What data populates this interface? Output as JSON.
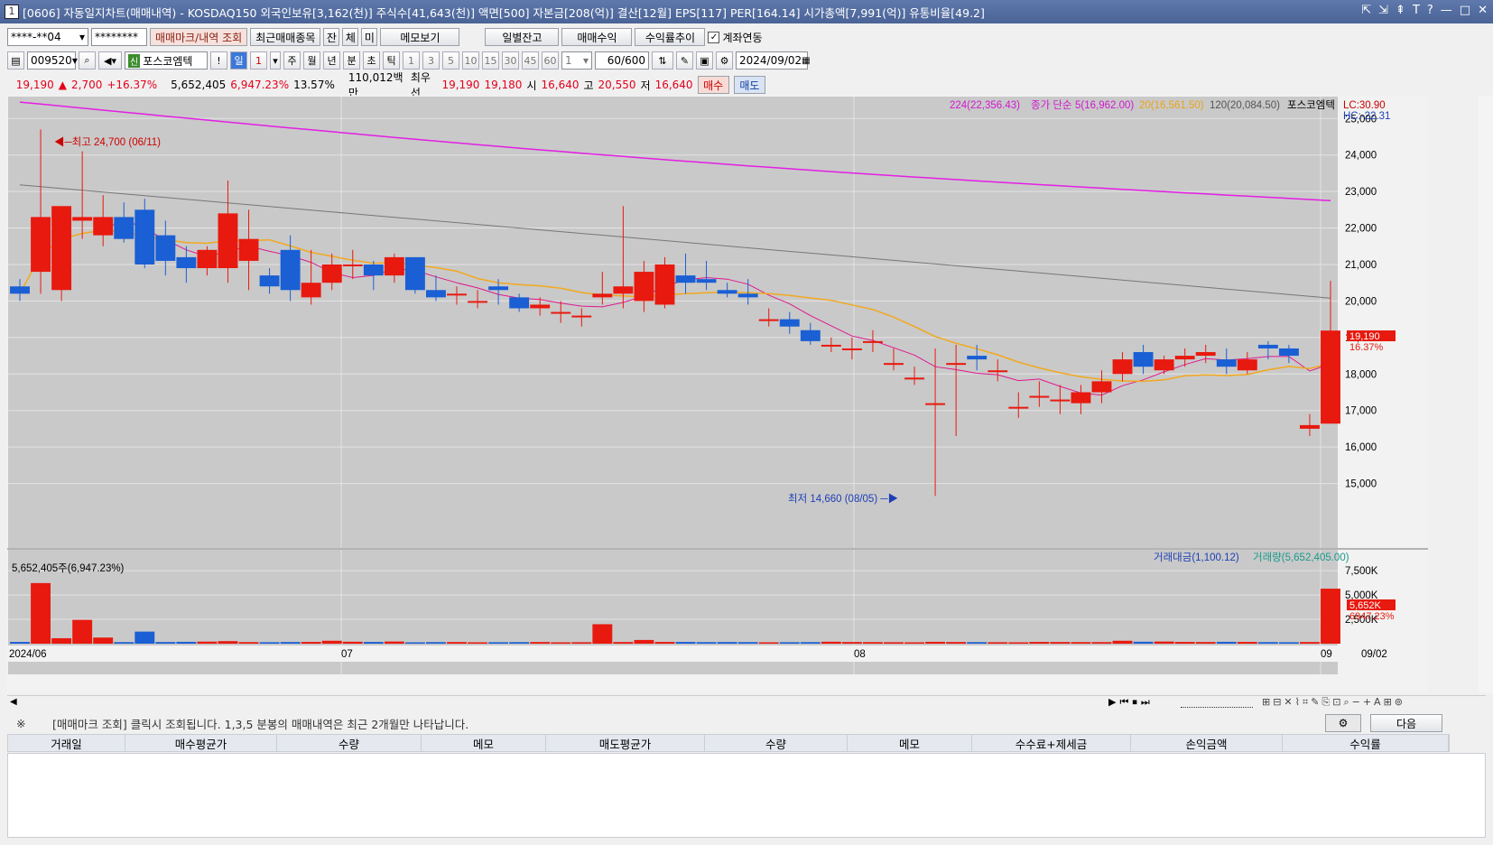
{
  "window": {
    "title": "[0606] 자동일지차트(매매내역) - KOSDAQ150 외국인보유[3,162(천)] 주식수[41,643(천)] 액면[500] 자본금[208(억)] 결산[12월] EPS[117] PER[164.14] 시가총액[7,991(억)] 유통비율[49.2]",
    "icon": "1",
    "controls": [
      "⇱",
      "⇲",
      "⇞",
      "T",
      "?",
      "—",
      "□",
      "✕"
    ]
  },
  "toolbar1": {
    "account": "****-**04",
    "password": "********",
    "trade_mark": "매매마크/내역 조회",
    "recent": "최근매매종목",
    "jan": "잔",
    "che": "체",
    "mi": "미",
    "memo": "메모보기",
    "daily": "일별잔고",
    "profit": "매매수익",
    "rate": "수익률추이",
    "link_checked": true,
    "link": "계좌연동"
  },
  "toolbar2": {
    "code": "009520",
    "stock_tag": "신",
    "stock_name": "포스코엠텍",
    "excl": "!",
    "period_labels": [
      "일",
      "1",
      "주",
      "월",
      "년",
      "분",
      "초",
      "틱"
    ],
    "minute_labels": [
      "1",
      "3",
      "5",
      "10",
      "15",
      "30",
      "45",
      "60"
    ],
    "nval": "1",
    "count": "60",
    "total": "/600",
    "date": "2024/09/02"
  },
  "pricebar": {
    "price": "19,190",
    "arrow": "▲",
    "change": "2,700",
    "pct": "+16.37%",
    "volume": "5,652,405",
    "vol_pct": "6,947.23%",
    "turnover": "13.57%",
    "amount": "110,012백만",
    "quote_label": "최우선",
    "ask": "19,190",
    "bid": "19,180",
    "open_label": "시",
    "open": "16,640",
    "high_label": "고",
    "high": "20,550",
    "low_label": "저",
    "low": "16,640",
    "buy": "매수",
    "sell": "매도"
  },
  "chart": {
    "legend": {
      "ma224": "224(22,356.43)",
      "ma_type": "종가 단순",
      "ma5": "5(16,962.00)",
      "ma20": "20(16,561.50)",
      "ma120": "120(20,084.50)",
      "stock": "포스코엠텍",
      "lc": "LC:30.90",
      "hc": "HC:-22.31"
    },
    "high_note": "최고 24,700 (06/11)",
    "low_note": "최저 14,660 (08/05)",
    "last_price": "19,190",
    "last_pct": "16.37%",
    "price_ticks": [
      "25,000",
      "24,000",
      "23,000",
      "22,000",
      "21,000",
      "20,000",
      "19,000",
      "18,000",
      "17,000",
      "16,000",
      "15,000"
    ],
    "vol_legend": {
      "amount": "거래대금(1,100.12)",
      "volume": "거래량(5,652,405.00)"
    },
    "vol_note": "5,652,405주(6,947.23%)",
    "vol_last": "5,652K",
    "vol_last_pct": "6947.23%",
    "vol_ticks": [
      "7,500K",
      "5,000K",
      "2,500K"
    ],
    "x_labels": [
      "2024/06",
      "07",
      "08",
      "09",
      "09/02"
    ],
    "colors": {
      "up": "#e8190e",
      "down": "#1a5fd4",
      "ma5": "#e0188e",
      "ma20": "#f2a81d",
      "ma120": "#777777",
      "ma224": "#e41ee4",
      "bg": "#c9c9c9"
    }
  },
  "chart_data": {
    "type": "candlestick",
    "x": [
      "06/03",
      "06/04",
      "06/05",
      "06/07",
      "06/10",
      "06/11",
      "06/12",
      "06/13",
      "06/14",
      "06/17",
      "06/18",
      "06/19",
      "06/20",
      "06/21",
      "06/24",
      "06/25",
      "06/26",
      "06/27",
      "06/28",
      "07/01",
      "07/02",
      "07/03",
      "07/04",
      "07/05",
      "07/08",
      "07/09",
      "07/10",
      "07/11",
      "07/12",
      "07/15",
      "07/16",
      "07/17",
      "07/18",
      "07/19",
      "07/22",
      "07/23",
      "07/24",
      "07/25",
      "07/26",
      "07/29",
      "07/30",
      "07/31",
      "08/01",
      "08/02",
      "08/05",
      "08/06",
      "08/07",
      "08/08",
      "08/09",
      "08/12",
      "08/13",
      "08/14",
      "08/16",
      "08/19",
      "08/20",
      "08/21",
      "08/22",
      "08/23",
      "08/26",
      "08/27",
      "08/28",
      "08/29",
      "08/30",
      "09/02"
    ],
    "open": [
      20400,
      20800,
      20300,
      22200,
      21800,
      22300,
      22500,
      21800,
      21200,
      20900,
      20900,
      21100,
      20700,
      21400,
      20100,
      20500,
      21000,
      21000,
      20700,
      21200,
      20300,
      20200,
      20000,
      20400,
      20100,
      19800,
      19700,
      19600,
      20100,
      20200,
      20000,
      19900,
      20700,
      20600,
      20300,
      20200,
      19500,
      19500,
      19200,
      18800,
      18700,
      18900,
      18300,
      17900,
      17200,
      18300,
      18500,
      18100,
      17100,
      17400,
      17300,
      17200,
      17500,
      18000,
      18600,
      18100,
      18400,
      18500,
      18400,
      18100,
      18800,
      18700,
      16500,
      16640
    ],
    "close": [
      20200,
      22300,
      22600,
      22300,
      22300,
      21700,
      21000,
      21100,
      20900,
      21400,
      22400,
      21700,
      20400,
      20300,
      20500,
      21000,
      21000,
      20700,
      21200,
      20300,
      20100,
      20200,
      20000,
      20300,
      19800,
      19900,
      19700,
      19600,
      20200,
      20400,
      20800,
      21000,
      20500,
      20500,
      20200,
      20100,
      19500,
      19300,
      18900,
      18800,
      18700,
      18900,
      18300,
      17900,
      17200,
      18300,
      18400,
      18100,
      17100,
      17400,
      17300,
      17500,
      17800,
      18400,
      18200,
      18400,
      18500,
      18600,
      18200,
      18400,
      18700,
      18500,
      16600,
      19190
    ],
    "high": [
      20600,
      24700,
      22500,
      24100,
      22900,
      22700,
      22800,
      22200,
      21500,
      21500,
      23300,
      22500,
      20900,
      21800,
      21400,
      21300,
      21400,
      21100,
      21300,
      21200,
      20700,
      20400,
      20300,
      20600,
      20200,
      20100,
      20000,
      19800,
      20800,
      22600,
      21100,
      21200,
      21300,
      21100,
      20500,
      20600,
      19800,
      19700,
      19400,
      19000,
      19000,
      19200,
      18700,
      18200,
      18700,
      18800,
      18800,
      18400,
      17500,
      17800,
      17700,
      17700,
      18100,
      18600,
      18800,
      18500,
      18700,
      18800,
      18700,
      18600,
      18900,
      18800,
      16900,
      20550
    ],
    "low": [
      20000,
      20200,
      20000,
      21700,
      21500,
      21600,
      20900,
      20700,
      20500,
      20700,
      20500,
      20300,
      20200,
      20000,
      19900,
      20300,
      20600,
      20300,
      20500,
      20200,
      20000,
      19900,
      19800,
      19900,
      19700,
      19600,
      19400,
      19300,
      19900,
      19800,
      19700,
      19800,
      20200,
      20300,
      20100,
      19900,
      19300,
      19100,
      18800,
      18600,
      18400,
      18600,
      18100,
      17700,
      14660,
      16300,
      18100,
      17800,
      16800,
      17100,
      16900,
      16900,
      17200,
      17800,
      18000,
      18000,
      18200,
      18300,
      18000,
      18000,
      18400,
      18300,
      16300,
      16640
    ],
    "volume": [
      180,
      6230,
      560,
      2450,
      630,
      160,
      1240,
      170,
      190,
      210,
      260,
      160,
      150,
      170,
      180,
      300,
      200,
      180,
      220,
      140,
      160,
      170,
      140,
      150,
      160,
      170,
      140,
      150,
      2000,
      170,
      380,
      180,
      180,
      160,
      170,
      160,
      140,
      150,
      160,
      200,
      170,
      160,
      150,
      140,
      190,
      170,
      160,
      150,
      140,
      180,
      170,
      160,
      160,
      300,
      200,
      220,
      180,
      170,
      190,
      180,
      160,
      150,
      170,
      5652
    ],
    "volume_unit": "K",
    "ylim": [
      14000,
      25600
    ],
    "series": [
      {
        "name": "5"
      },
      {
        "name": "20"
      },
      {
        "name": "120"
      },
      {
        "name": "224"
      }
    ]
  },
  "notice": {
    "mark": "※",
    "text": "[매매마크 조회] 클릭시 조회됩니다. 1,3,5 분봉의 매매내역은 최근 2개월만 나타납니다.",
    "next": "다음"
  },
  "table": {
    "headers": [
      "거래일",
      "매수평균가",
      "수량",
      "메모",
      "매도평균가",
      "수량",
      "메모",
      "수수료+제세금",
      "손익금액",
      "수익률"
    ]
  }
}
